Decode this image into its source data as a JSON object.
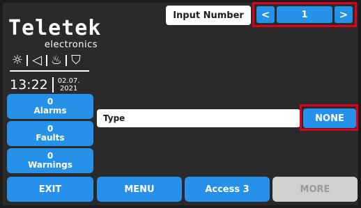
{
  "brand": {
    "name": "Teletek",
    "subtitle": "electronics"
  },
  "status_icons": [
    {
      "name": "sun-icon",
      "glyph": "☼"
    },
    {
      "name": "speaker-icon",
      "glyph": "◁"
    },
    {
      "name": "flame-icon",
      "glyph": "♨"
    },
    {
      "name": "extinguisher-icon",
      "glyph": "⛉"
    }
  ],
  "clock": {
    "time": "13:22",
    "date_day_month": "02.07.",
    "date_year": "2021"
  },
  "header": {
    "label": "Input Number",
    "prev_symbol": "<",
    "value": "1",
    "next_symbol": ">"
  },
  "counters": {
    "alarms": {
      "count": "0",
      "label": "Alarms"
    },
    "faults": {
      "count": "0",
      "label": "Faults"
    },
    "warnings": {
      "count": "0",
      "label": "Warnings"
    }
  },
  "field": {
    "label": "Type",
    "value": "NONE"
  },
  "bottom": {
    "exit": "EXIT",
    "menu": "MENU",
    "access": "Access 3",
    "more": "MORE"
  },
  "colors": {
    "background": "#2a2a2a",
    "accent": "#2591e8",
    "highlight": "#e3001b",
    "disabled": "#d0d0d0"
  }
}
